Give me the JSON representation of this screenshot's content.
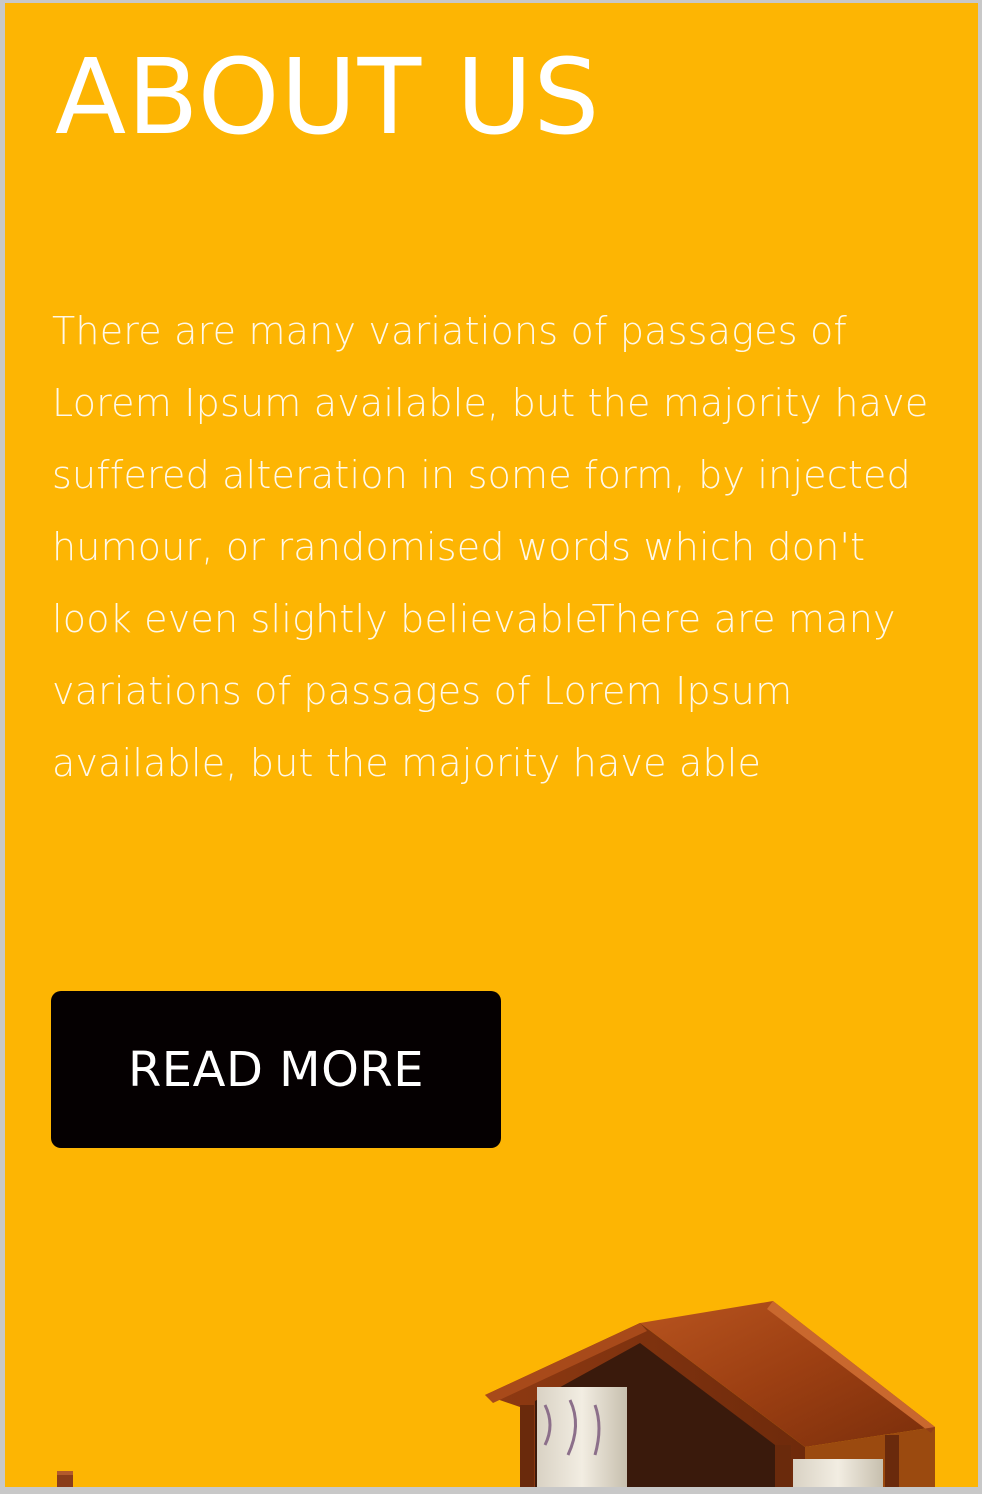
{
  "about": {
    "title": "ABOUT US",
    "paragraph": "There are many variations of passages of Lorem Ipsum available, but the majority have suffered alteration in some form, by injected humour, or randomised words which don't look even slightly believableThere are many variations of passages of Lorem Ipsum available, but the majority have able",
    "read_more_label": "READ MORE"
  },
  "colors": {
    "background": "#fdb503",
    "button": "#050001",
    "text": "#ffffff"
  },
  "images": {
    "house": "wooden-birdhouse-image"
  }
}
